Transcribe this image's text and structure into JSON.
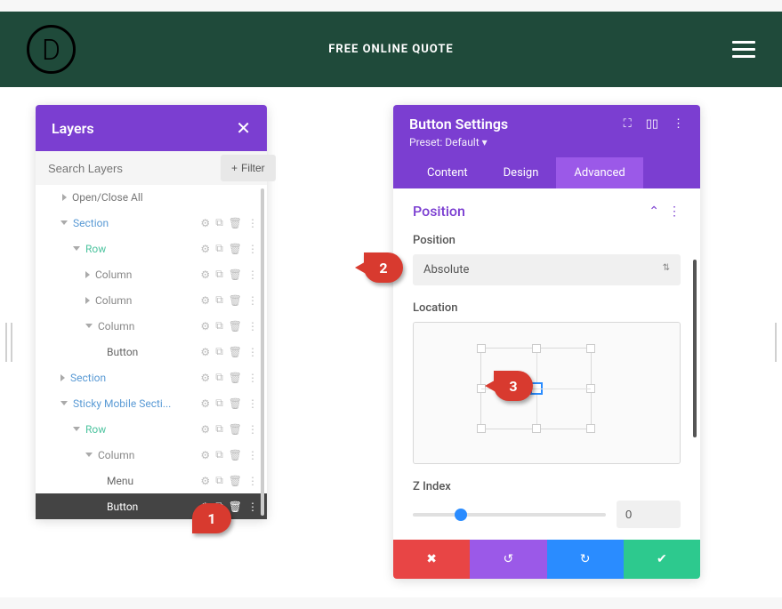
{
  "topbar": {
    "logo_letter": "D",
    "quote": "FREE ONLINE QUOTE"
  },
  "layers": {
    "title": "Layers",
    "search_placeholder": "Search Layers",
    "filter_label": "Filter",
    "open_close": "Open/Close All",
    "items": [
      {
        "label": "Section",
        "type": "section",
        "caret": "down",
        "indent": 1
      },
      {
        "label": "Row",
        "type": "row",
        "caret": "down",
        "indent": 2
      },
      {
        "label": "Column",
        "type": "col",
        "caret": "right",
        "indent": 3
      },
      {
        "label": "Column",
        "type": "col",
        "caret": "right",
        "indent": 3
      },
      {
        "label": "Column",
        "type": "col",
        "caret": "down",
        "indent": 3
      },
      {
        "label": "Button",
        "type": "plain",
        "indent": 4
      },
      {
        "label": "Section",
        "type": "section",
        "caret": "right",
        "indent": 1
      },
      {
        "label": "Sticky Mobile Secti...",
        "type": "section",
        "caret": "down",
        "indent": 1
      },
      {
        "label": "Row",
        "type": "row",
        "caret": "down",
        "indent": 2
      },
      {
        "label": "Column",
        "type": "col",
        "caret": "down",
        "indent": 3
      },
      {
        "label": "Menu",
        "type": "plain",
        "indent": 4
      },
      {
        "label": "Button",
        "type": "plain",
        "indent": 4,
        "active": true
      }
    ]
  },
  "settings": {
    "title": "Button Settings",
    "preset": "Preset: Default ▾",
    "tabs": {
      "content": "Content",
      "design": "Design",
      "advanced": "Advanced"
    },
    "section_title": "Position",
    "position_label": "Position",
    "position_value": "Absolute",
    "location_label": "Location",
    "zindex_label": "Z Index",
    "zindex_value": "0"
  },
  "callouts": {
    "c1": "1",
    "c2": "2",
    "c3": "3"
  }
}
